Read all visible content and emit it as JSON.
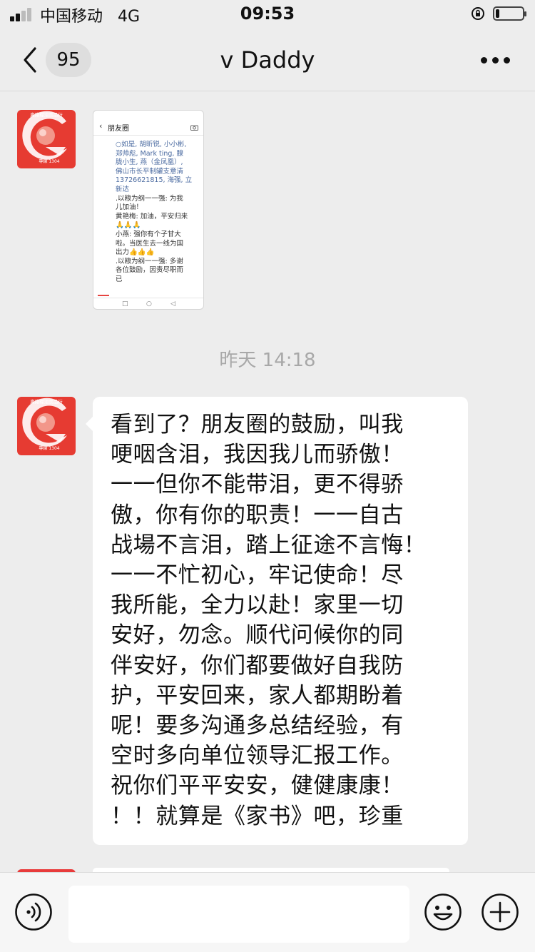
{
  "status_bar": {
    "carrier": "中国移动",
    "network": "4G",
    "time": "09:53",
    "battery_level": 0.15,
    "icons": [
      "signal-icon",
      "orientation-lock-icon",
      "battery-icon"
    ]
  },
  "nav": {
    "unread_count": "95",
    "title": "v Daddy",
    "icons": [
      "back-icon",
      "more-icon"
    ]
  },
  "avatar": {
    "store_name": "廣路糧油食品行",
    "store_phone": "專線 1304",
    "colors": {
      "bg": "#e63b32",
      "ball": "#f08a7a"
    }
  },
  "thumbnail": {
    "page_title": "朋友圈",
    "back_glyph": "‹",
    "lines": [
      {
        "text": "○如是, 胡昕锐, 小小彬,",
        "blue": true
      },
      {
        "text": "郑帅彪, Mark ting, 腺",
        "blue": true
      },
      {
        "text": "胧小生, 燕（金凤凰）,",
        "blue": true
      },
      {
        "text": "佛山市长平制罐支意清",
        "blue": true
      },
      {
        "text": "13726621815, 海强, 立",
        "blue": true
      },
      {
        "text": "新达",
        "blue": true
      },
      {
        "text": ".以粮为纲一一强: 为我",
        "blue": false
      },
      {
        "text": "儿加油！",
        "blue": false
      },
      {
        "text": "黄艳梅: 加油，平安归来",
        "blue": false
      },
      {
        "text": "🙏🙏🙏",
        "blue": false
      },
      {
        "text": "小燕: 强你有个子甘大",
        "blue": false
      },
      {
        "text": "啦。当医生去一线为国",
        "blue": false
      },
      {
        "text": "出力👍👍👍",
        "blue": false
      },
      {
        "text": ".以粮为纲一一强: 多谢",
        "blue": false
      },
      {
        "text": "各位鼓励，因责尽职而",
        "blue": false
      },
      {
        "text": "已",
        "blue": false
      }
    ]
  },
  "time_divider": "昨天 14:18",
  "message": {
    "lines": [
      "看到了？朋友圈的鼓励，叫我",
      "哽咽含泪，我因我儿而骄傲！",
      "一一但你不能带泪，更不得骄",
      "傲，你有你的职责！一一自古",
      "战場不言泪，踏上征途不言悔！",
      "一一不忙初心，牢记使命！尽",
      "我所能，全力以赴！家里一切",
      "安好，勿念。顺代问候你的同",
      "伴安好，你们都要做好自我防",
      "护，平安回来，家人都期盼着",
      "呢！要多沟通多总结经验，有",
      "空时多向单位领导汇报工作。",
      "祝你们平平安安，健健康康！",
      "！！就算是《家书》吧，珍重"
    ]
  },
  "input_bar": {
    "placeholder": "",
    "icons": [
      "voice-icon",
      "emoji-icon",
      "plus-icon"
    ]
  }
}
